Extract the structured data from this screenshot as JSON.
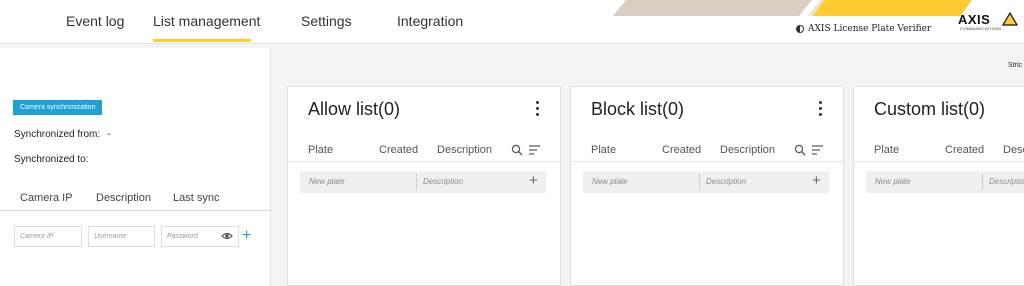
{
  "nav": {
    "tabs": [
      {
        "label": "Event log"
      },
      {
        "label": "List management"
      },
      {
        "label": "Settings"
      },
      {
        "label": "Integration"
      }
    ],
    "active_tab": "List management",
    "accent_color": "#ffcc33"
  },
  "brand": {
    "product_name": "AXIS License Plate Verifier",
    "logo_word": "AXIS",
    "logo_sub": "COMMUNICATIONS"
  },
  "sync": {
    "button_label": "Camera synchronization",
    "from_label": "Synchronized from:",
    "from_value": "-",
    "to_label": "Synchronized to:",
    "to_value": ""
  },
  "camera_table": {
    "columns": [
      "Camera IP",
      "Description",
      "Last sync"
    ],
    "inputs": {
      "camera_ip_placeholder": "Camera IP",
      "username_placeholder": "Username",
      "password_placeholder": "Password"
    },
    "accent_color": "#1ea0d9"
  },
  "strict_label": "Stric",
  "lists": [
    {
      "title": "Allow list(0)",
      "columns": [
        "Plate",
        "Created",
        "Description"
      ],
      "plate_placeholder": "New plate",
      "description_placeholder": "Description"
    },
    {
      "title": "Block list(0)",
      "columns": [
        "Plate",
        "Created",
        "Description"
      ],
      "plate_placeholder": "New plate",
      "description_placeholder": "Description"
    },
    {
      "title": "Custom list(0)",
      "columns": [
        "Plate",
        "Created",
        "Description"
      ],
      "plate_placeholder": "New plate",
      "description_placeholder": "Description"
    }
  ]
}
